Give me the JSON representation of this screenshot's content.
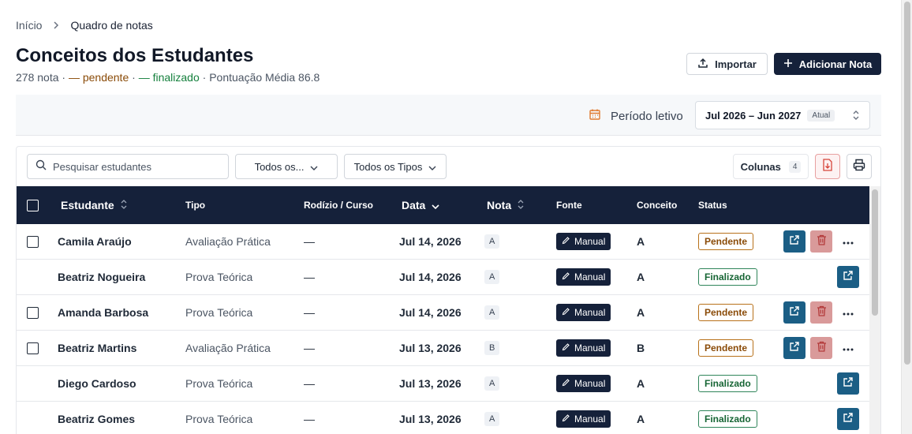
{
  "breadcrumb": {
    "home": "Início",
    "current": "Quadro de notas"
  },
  "header": {
    "title": "Conceitos dos Estudantes",
    "summary": {
      "count": "278 nota",
      "sep1": " · ",
      "pending": "— pendente",
      "sep2": " · ",
      "finished": "— finalizado",
      "sep3": " · ",
      "average": "Pontuação Média 86.8"
    }
  },
  "actions": {
    "import_label": "Importar",
    "add_label": "Adicionar Nota"
  },
  "period": {
    "label": "Período letivo",
    "value": "Jul 2026 – Jun 2027",
    "badge": "Atual"
  },
  "toolbar": {
    "search_placeholder": "Pesquisar estudantes",
    "filter1": "Todos os...",
    "filter2": "Todos os Tipos",
    "columns_label": "Colunas",
    "columns_count": "4"
  },
  "table": {
    "headers": {
      "student": "Estudante",
      "type": "Tipo",
      "rotation": "Rodízio / Curso",
      "date": "Data",
      "grade": "Nota",
      "source": "Fonte",
      "concept": "Conceito",
      "status": "Status"
    },
    "rows": [
      {
        "student": "Camila Araújo",
        "type": "Avaliação Prática",
        "rotation": "—",
        "date": "Jul 14, 2026",
        "grade": "A",
        "source": "Manual",
        "concept": "A",
        "status": "Pendente"
      },
      {
        "student": "Beatriz Nogueira",
        "type": "Prova Teórica",
        "rotation": "—",
        "date": "Jul 14, 2026",
        "grade": "A",
        "source": "Manual",
        "concept": "A",
        "status": "Finalizado"
      },
      {
        "student": "Amanda Barbosa",
        "type": "Prova Teórica",
        "rotation": "—",
        "date": "Jul 14, 2026",
        "grade": "A",
        "source": "Manual",
        "concept": "A",
        "status": "Pendente"
      },
      {
        "student": "Beatriz Martins",
        "type": "Avaliação Prática",
        "rotation": "—",
        "date": "Jul 13, 2026",
        "grade": "B",
        "source": "Manual",
        "concept": "B",
        "status": "Pendente"
      },
      {
        "student": "Diego Cardoso",
        "type": "Prova Teórica",
        "rotation": "—",
        "date": "Jul 13, 2026",
        "grade": "A",
        "source": "Manual",
        "concept": "A",
        "status": "Finalizado"
      },
      {
        "student": "Beatriz Gomes",
        "type": "Prova Teórica",
        "rotation": "—",
        "date": "Jul 13, 2026",
        "grade": "A",
        "source": "Manual",
        "concept": "A",
        "status": "Finalizado"
      }
    ]
  },
  "colors": {
    "navy": "#15213a",
    "accent_blue": "#1b5e85",
    "pending": "#8a4b08",
    "finished": "#166534",
    "delete": "#d99a9a"
  }
}
